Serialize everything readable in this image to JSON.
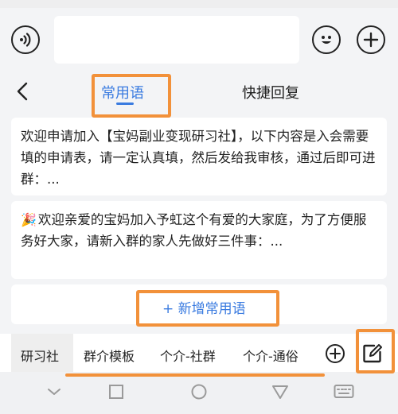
{
  "input_bar": {
    "voice_icon": "voice-wave-icon",
    "emoji_icon": "smiley-icon",
    "plus_icon": "plus-circle-icon",
    "input_value": ""
  },
  "tabs": {
    "back_icon": "chevron-left-icon",
    "common_label": "常用语",
    "quick_label": "快捷回复"
  },
  "phrases": [
    {
      "text": "欢迎申请加入【宝妈副业变现研习社】，以下内容是入会需要填的申请表，请一定认真填，然后发给我审核，通过后即可进群：..."
    },
    {
      "icon": "🎉",
      "text": "欢迎亲爱的宝妈加入予虹这个有爱的大家庭，为了方便服务好大家，请新入群的家人先做好三件事：..."
    }
  ],
  "add_phrase_label": "+ 新增常用语",
  "categories": [
    "研习社",
    "群介模板",
    "个介-社群",
    "个介-通俗"
  ],
  "category_active_index": 0,
  "edit_icon": "edit-square-icon",
  "nav_icons": [
    "back-chevron-icon",
    "home-square-icon",
    "circle-icon",
    "triangle-icon",
    "keyboard-icon"
  ],
  "colors": {
    "accent": "#3a7be0",
    "highlight": "#f2913a",
    "background": "#f3f4f6",
    "card": "#ffffff"
  }
}
